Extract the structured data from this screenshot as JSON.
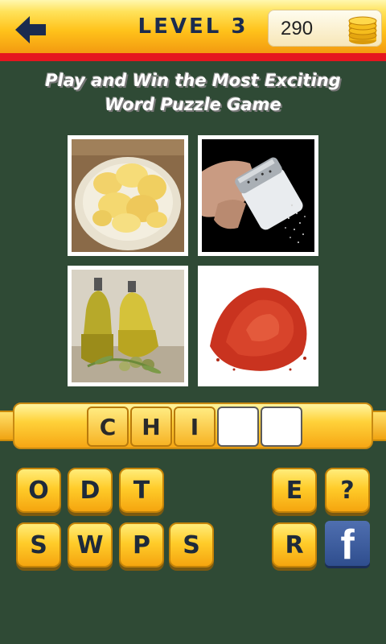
{
  "header": {
    "level_title": "LEVEL 3",
    "coins": "290",
    "back_icon": "arrow-left-icon",
    "coin_icon": "coin-stack-icon"
  },
  "tagline": {
    "line1": "Play and Win the Most Exciting",
    "line2": "Word Puzzle Game"
  },
  "photos": [
    {
      "subject": "potato chips in a bowl"
    },
    {
      "subject": "salt shaker pouring"
    },
    {
      "subject": "olive oil bottles with olives"
    },
    {
      "subject": "red chili powder pile"
    }
  ],
  "answer": {
    "slots": [
      "C",
      "H",
      "I",
      "",
      ""
    ]
  },
  "letters": {
    "row1": [
      "O",
      "D",
      "T",
      "E",
      "?"
    ],
    "row2": [
      "S",
      "W",
      "P",
      "S",
      "R"
    ]
  },
  "social": {
    "facebook_label": "f"
  },
  "colors": {
    "background": "#2f4a35",
    "topbar_accent": "#e5161f",
    "key_gold": "#ffcc2a",
    "title_navy": "#1b2b4f",
    "facebook_blue": "#3b5998"
  }
}
